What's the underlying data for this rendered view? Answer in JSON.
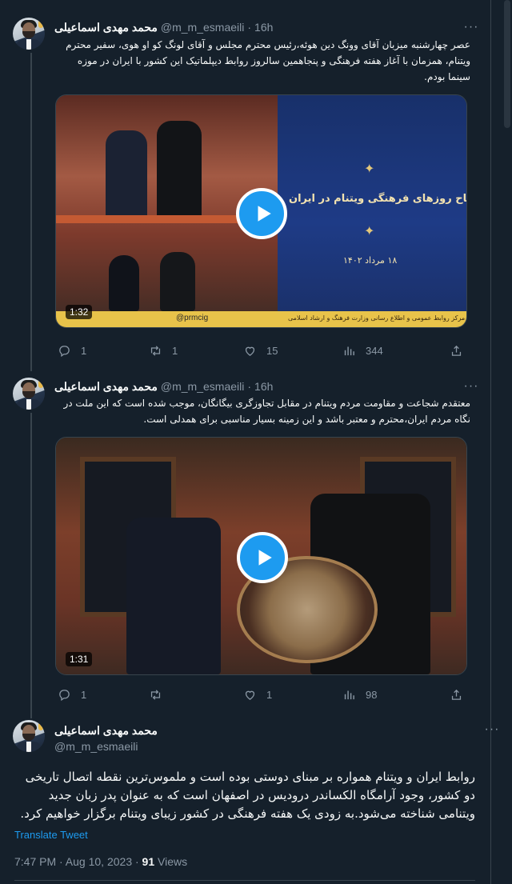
{
  "tweets": [
    {
      "author_name": "محمد مهدی اسماعیلی",
      "handle": "@m_m_esmaeili",
      "dot": "·",
      "time": "16h",
      "text": "عصر چهارشنبه میزبان آقای وونگ دین هوئه،رئیس محترم مجلس و آقای لونگ کو او هوی، سفیر محترم ویتنام، همزمان با آغاز هفته فرهنگی و پنجاهمین سالروز روابط دیپلماتیک این کشور با ایران در موزه سینما بودم.",
      "video": {
        "duration": "1:32",
        "banner_title": "افتتاح روزهای فرهنگی ویتنام در ایران",
        "banner_date": "۱۸ مرداد ۱۴۰۲",
        "footer_text": "مرکز روابط عمومی و اطلاع رسانی وزارت فرهنگ و ارشاد اسلامی",
        "footer_handle": "@prmcig"
      },
      "stats": {
        "replies": "1",
        "retweets": "1",
        "likes": "15",
        "views": "344"
      }
    },
    {
      "author_name": "محمد مهدی اسماعیلی",
      "handle": "@m_m_esmaeili",
      "dot": "·",
      "time": "16h",
      "text": "معتقدم شجاعت و مقاومت مردم ویتنام در مقابل تجاوزگری بیگانگان، موجب شده است که این ملت در نگاه مردم ایران،محترم و معتبر باشد و این زمینه بسیار مناسبی برای همدلی است.",
      "video": {
        "duration": "1:31"
      },
      "stats": {
        "replies": "1",
        "retweets": "",
        "likes": "1",
        "views": "98"
      }
    }
  ],
  "main_tweet": {
    "author_name": "محمد مهدی اسماعیلی",
    "handle": "@m_m_esmaeili",
    "text": "روابط ایران و ویتنام همواره بر مبنای دوستی  بوده است و ملموس‌ترین نقطه اتصال تاریخی دو کشور، وجود آرامگاه الکساندر درودیس در اصفهان است که به عنوان پدر زبان جدید ویتنامی شناخته می‌شود.به زودی یک هفته فرهنگی در کشور زیبای ویتنام برگزار خواهیم کرد.",
    "translate_label": "Translate Tweet",
    "timestamp": "7:47 PM · Aug 10, 2023 ·",
    "views_count": "91",
    "views_label": "Views"
  },
  "icons": {
    "more": "more-horizontal-icon",
    "reply": "reply-icon",
    "retweet": "retweet-icon",
    "like": "heart-icon",
    "views": "bar-chart-icon",
    "share": "share-icon",
    "play": "play-icon"
  },
  "colors": {
    "background": "#15202b",
    "accent": "#1d9bf0",
    "muted": "#8b98a5",
    "border": "#38444d"
  }
}
